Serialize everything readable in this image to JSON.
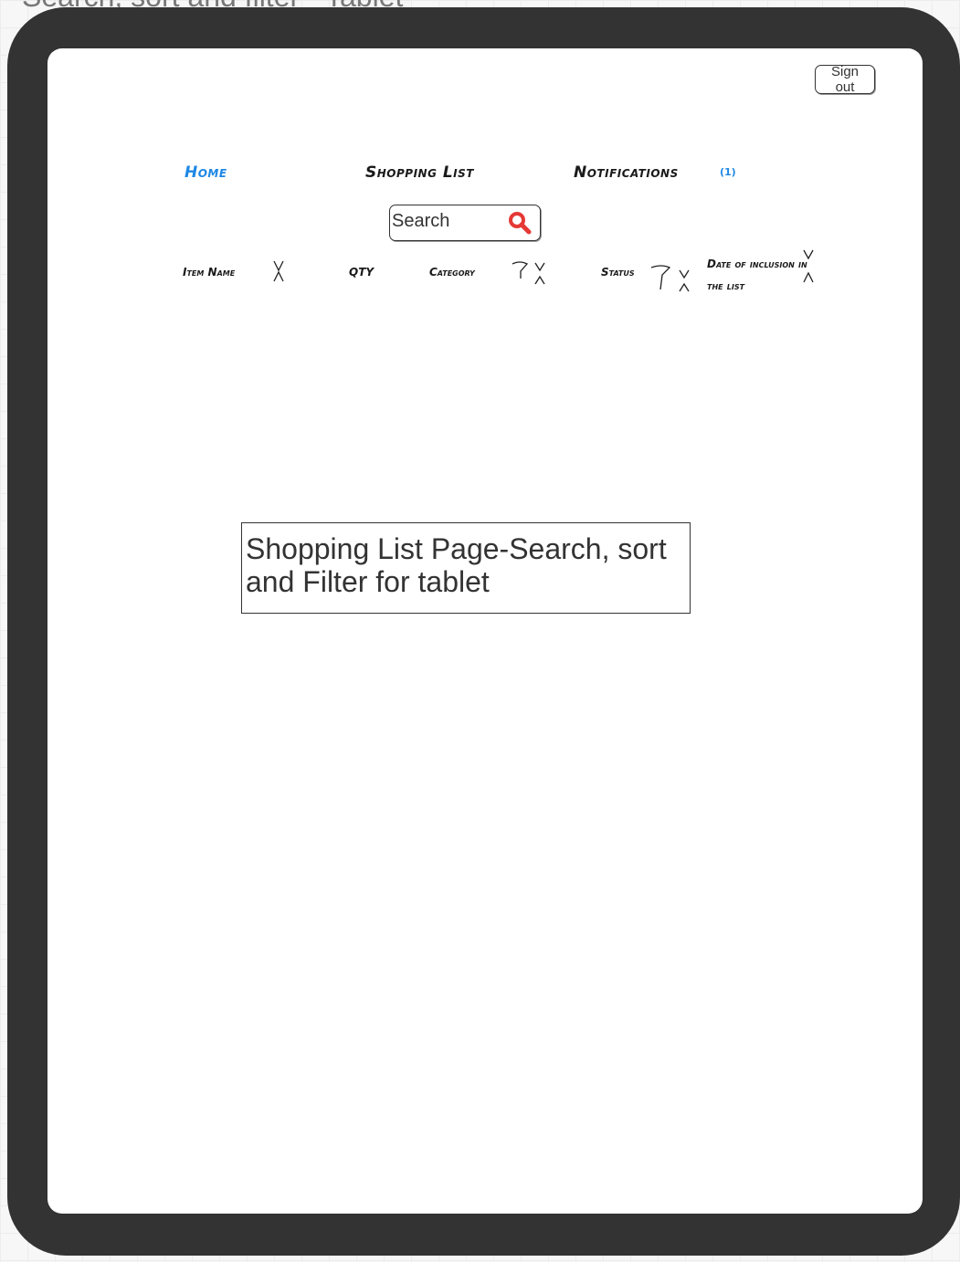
{
  "page_caption": "Search, sort and filter - Tablet",
  "header": {
    "sign_out_label": "Sign out"
  },
  "nav": {
    "home": "Home",
    "shopping_list": "Shopping List",
    "notifications": "Notifications",
    "notifications_count": "(1)",
    "active_color": "#1e88e5"
  },
  "search": {
    "placeholder": "Search",
    "icon": "search-icon",
    "icon_color": "#e53935"
  },
  "table": {
    "columns": [
      {
        "label": "Item Name",
        "sortable": true,
        "filterable": false
      },
      {
        "label": "QTY",
        "sortable": false,
        "filterable": false
      },
      {
        "label": "Category",
        "sortable": true,
        "filterable": true
      },
      {
        "label": "Status",
        "sortable": true,
        "filterable": true
      },
      {
        "label": "Date of inclusion in the list",
        "sortable": true,
        "filterable": false
      }
    ]
  },
  "caption_box": {
    "text": "Shopping List Page-Search, sort and Filter for tablet"
  },
  "colors": {
    "frame": "#333333",
    "screen": "#ffffff"
  }
}
